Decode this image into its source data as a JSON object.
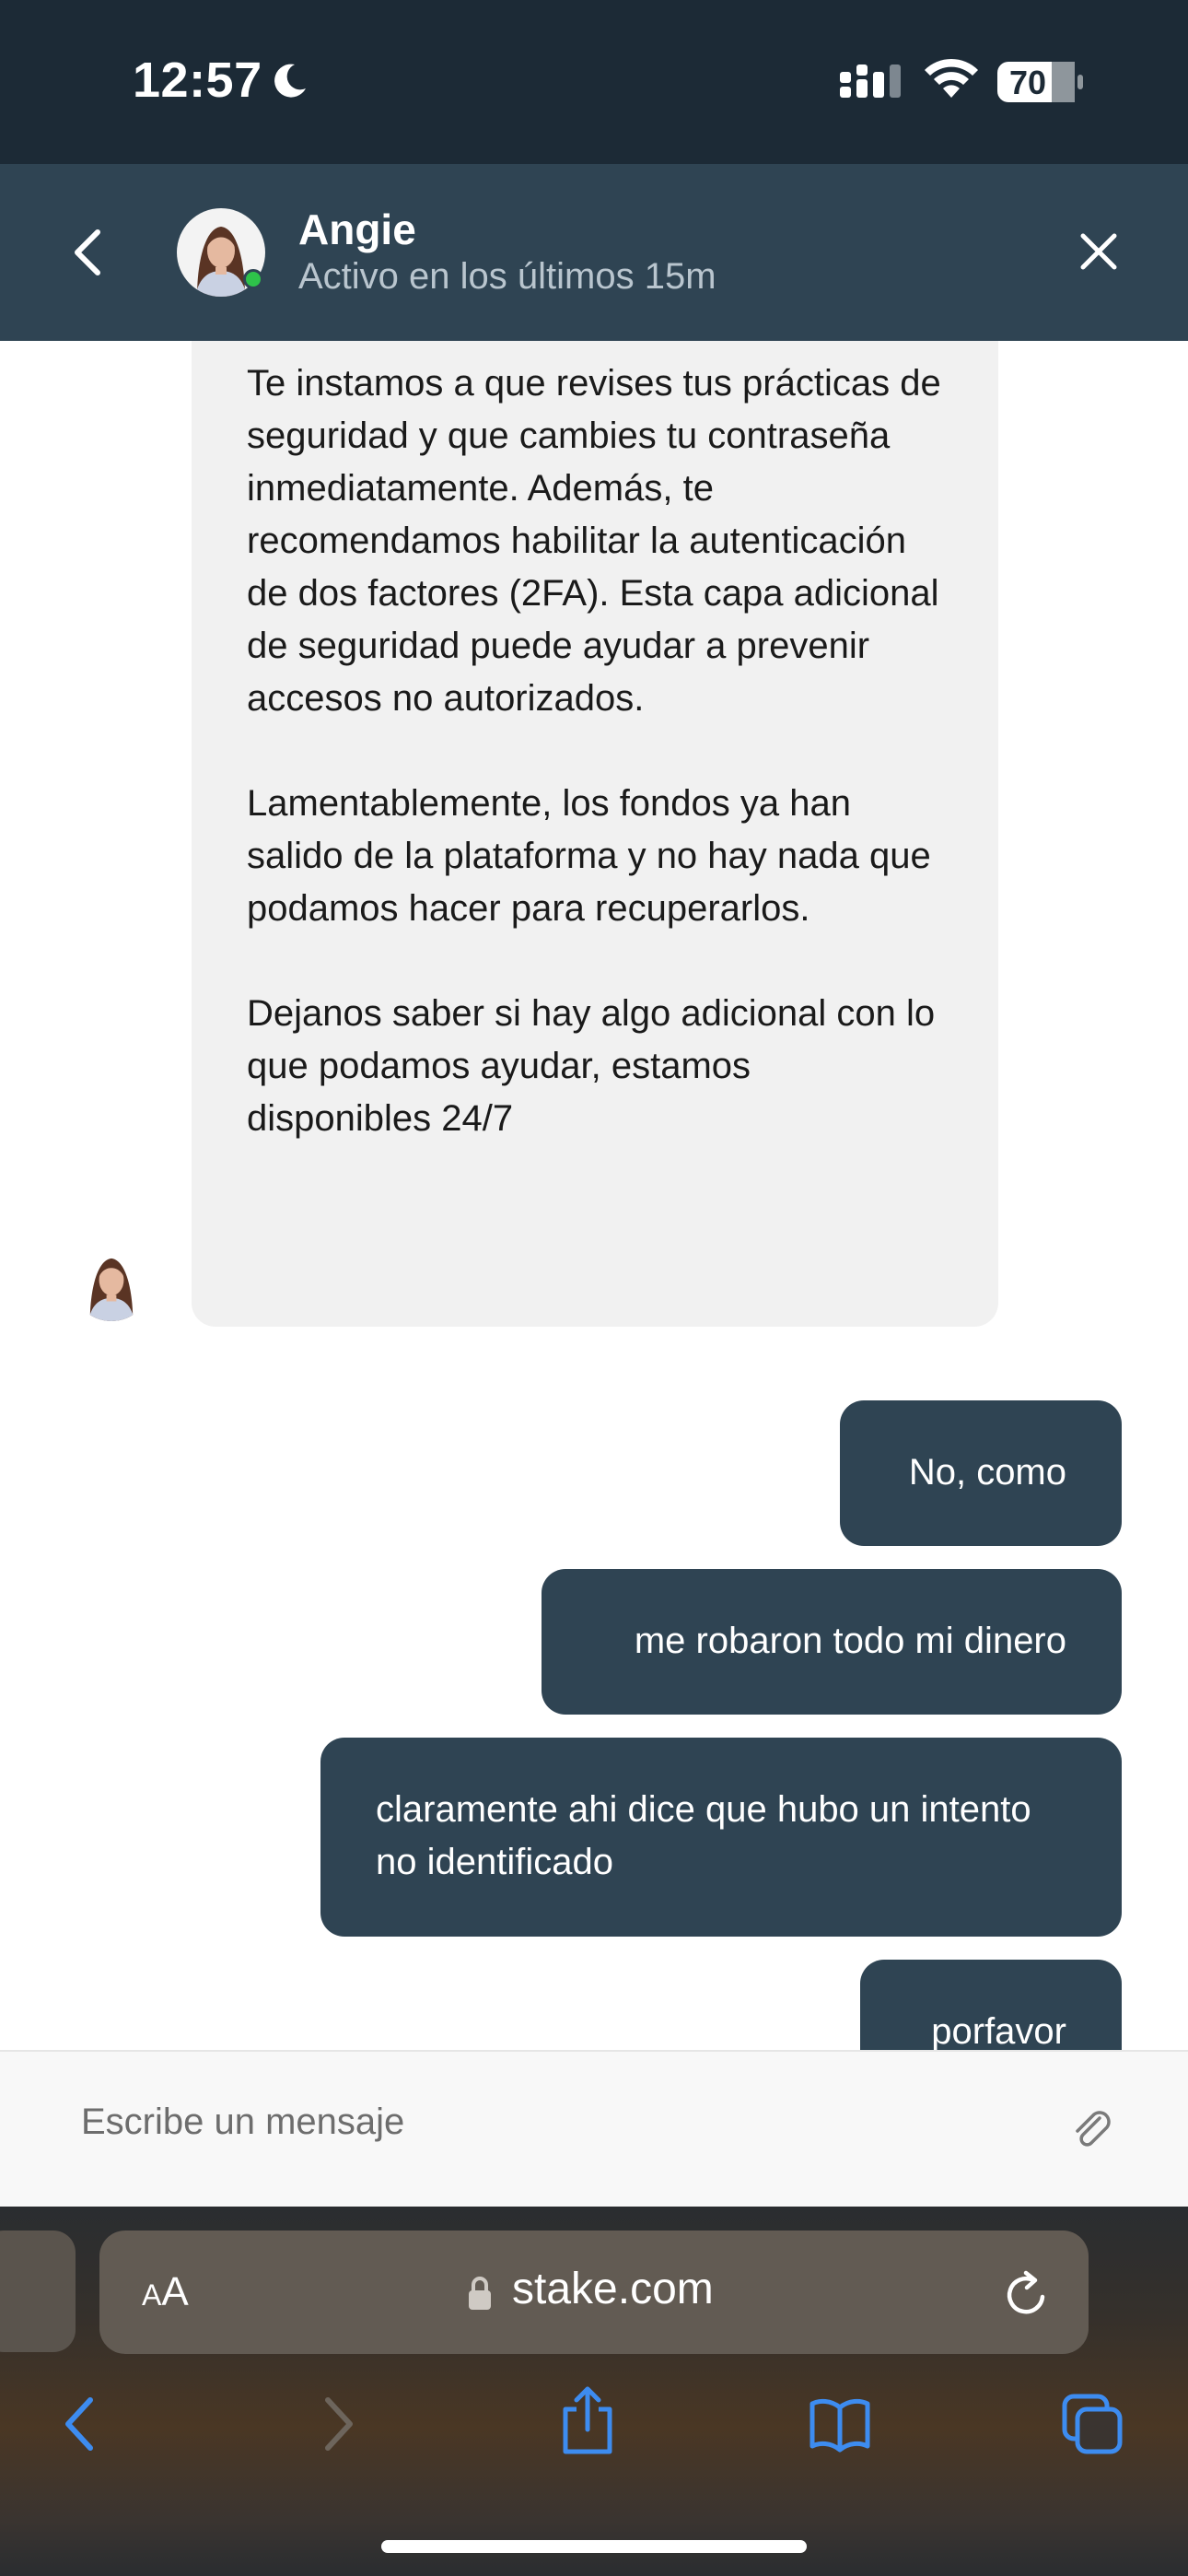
{
  "status_bar": {
    "time": "12:57",
    "battery": "70",
    "icons": [
      "moon-icon",
      "cellular-signal-icon",
      "wifi-icon",
      "battery-icon"
    ]
  },
  "chat_header": {
    "agent_name": "Angie",
    "agent_status": "Activo en los últimos 15m",
    "online_color": "#2ec24a",
    "icons": [
      "back-chevron-icon",
      "close-icon"
    ]
  },
  "messages": {
    "incoming": {
      "p1": "Te instamos a que revises tus prácticas de seguridad y que cambies tu contraseña inmediatamente. Además, te recomendamos habilitar la autenticación de dos factores (2FA). Esta capa adicional de seguridad puede ayudar a prevenir accesos no autorizados.",
      "p2": "Lamentablemente, los fondos ya han salido de la plataforma y no hay nada que podamos hacer para recuperarlos.",
      "p3": "Dejanos saber si hay algo adicional con lo que podamos ayudar, estamos disponibles 24/7"
    },
    "outgoing": [
      "No, como",
      "me robaron todo mi dinero",
      "claramente ahi dice que hubo un intento no identificado",
      "porfavor"
    ]
  },
  "composer": {
    "placeholder": "Escribe un mensaje",
    "icon": "paperclip-icon"
  },
  "browser": {
    "text_size_label_small": "A",
    "text_size_label_large": "A",
    "url": "stake.com",
    "icons": [
      "lock-icon",
      "reload-icon",
      "back-arrow-icon",
      "forward-arrow-icon",
      "share-icon",
      "bookmarks-icon",
      "tabs-icon"
    ]
  },
  "colors": {
    "header_bg": "#2f4453",
    "status_bar_bg": "#1c2a36",
    "outgoing_bubble": "#2f4453",
    "incoming_bubble": "#f1f1f1",
    "safari_accent": "#3d8cf0"
  }
}
